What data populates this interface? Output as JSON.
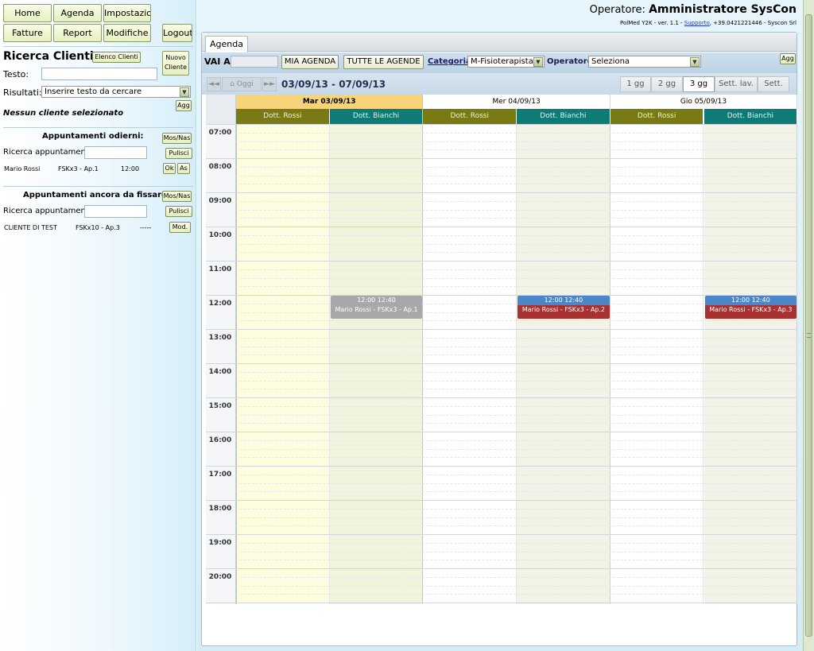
{
  "nav": {
    "home": "Home",
    "agenda": "Agenda",
    "impostazioni": "Impostazioni",
    "fatture": "Fatture",
    "report": "Report",
    "modifiche": "Modifiche",
    "logout": "Logout"
  },
  "search": {
    "title": "Ricerca Clienti:",
    "elenco_btn": "Elenco Clienti",
    "nuovo_btn": "Nuovo Cliente",
    "testo_label": "Testo:",
    "testo_value": "",
    "risultati_label": "Risultati:",
    "risultati_value": "Inserire testo da cercare",
    "agg_btn": "Agg",
    "no_client": "Nessun cliente selezionato"
  },
  "today": {
    "title": "Appuntamenti odierni:",
    "mos_btn": "Mos/Nas",
    "search_label": "Ricerca appuntamenti:",
    "pulisci_btn": "Pulisci",
    "row": {
      "name": "Mario Rossi",
      "code": "FSKx3 - Ap.1",
      "time": "12:00",
      "ok": "Ok",
      "as": "As"
    }
  },
  "pending": {
    "title": "Appuntamenti ancora da fissare:",
    "mos_btn": "Mos/Nas",
    "search_label": "Ricerca appuntamenti:",
    "pulisci_btn": "Pulisci",
    "row": {
      "name": "CLIENTE DI TEST",
      "code": "FSKx10 - Ap.3",
      "time": "-----",
      "mod": "Mod."
    }
  },
  "header": {
    "operatore_label": "Operatore:",
    "operatore_name": "Amministratore SysCon",
    "version": "PolMed Y2K - ver. 1.1 -",
    "supporto": "Supporto",
    "contact": ", +39.0421221446 - Syscon Srl"
  },
  "agenda": {
    "tab": "Agenda",
    "vai_label": "VAI A:",
    "mia_btn": "MIA AGENDA",
    "tutte_btn": "TUTTE LE AGENDE",
    "categoria_label": "Categoria:",
    "categoria_value": "M-Fisioterapista",
    "operatore_label": "Operatore:",
    "operatore_value": "Seleziona",
    "agg_btn": "Agg",
    "prev": "◄◄",
    "oggi": "Oggi",
    "next": "►►",
    "range": "03/09/13 - 07/09/13",
    "views": [
      "1 gg",
      "2 gg",
      "3 gg",
      "Sett. lav.",
      "Sett."
    ],
    "active_view": "3 gg"
  },
  "calendar": {
    "days": [
      {
        "label": "Mar 03/09/13",
        "today": true
      },
      {
        "label": "Mer 04/09/13",
        "today": false
      },
      {
        "label": "Gio 05/09/13",
        "today": false
      }
    ],
    "doctors": [
      "Dott. Rossi",
      "Dott. Bianchi",
      "Dott. Rossi",
      "Dott. Bianchi",
      "Dott. Rossi",
      "Dott. Bianchi"
    ],
    "hours": [
      "07:00",
      "08:00",
      "09:00",
      "10:00",
      "11:00",
      "12:00",
      "13:00",
      "14:00",
      "15:00",
      "16:00",
      "17:00",
      "18:00",
      "19:00",
      "20:00"
    ],
    "appointments": [
      {
        "column": 1,
        "time": "12:00 12:40",
        "desc": "Mario Rossi - FSKx3 - Ap.1",
        "head_color": "#a8a8a8",
        "body_color": "#a8a8a8"
      },
      {
        "column": 3,
        "time": "12:00 12:40",
        "desc": "Mario Rossi - FSKx3 - Ap.2",
        "head_color": "#4a86c8",
        "body_color": "#a83232"
      },
      {
        "column": 5,
        "time": "12:00 12:40",
        "desc": "Mario Rossi - FSKx3 - Ap.3",
        "head_color": "#4a86c8",
        "body_color": "#a83232"
      }
    ]
  },
  "colors": {
    "rossi_header": "#7a7a14",
    "bianchi_header": "#0f7b76",
    "today_header": "#f7d37a",
    "today_bg": "#fefde0",
    "today_alt_bg": "#f2f3dc",
    "alt_bg": "#f3f2e6"
  }
}
